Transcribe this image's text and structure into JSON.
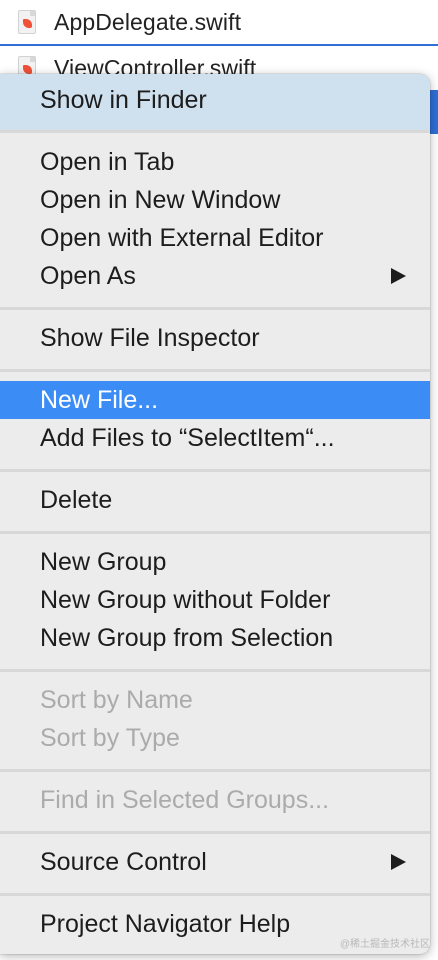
{
  "navigator": {
    "files": [
      {
        "name": "AppDelegate.swift",
        "icon": "swift-file-icon"
      },
      {
        "name": "ViewController.swift",
        "icon": "swift-file-icon"
      }
    ]
  },
  "context_menu": {
    "groups": [
      [
        {
          "label": "Show in Finder"
        }
      ],
      [
        {
          "label": "Open in Tab"
        },
        {
          "label": "Open in New Window"
        },
        {
          "label": "Open with External Editor"
        },
        {
          "label": "Open As",
          "submenu": true
        }
      ],
      [
        {
          "label": "Show File Inspector"
        }
      ],
      [
        {
          "label": "New File...",
          "highlighted": true
        },
        {
          "label": "Add Files to “SelectItem“..."
        }
      ],
      [
        {
          "label": "Delete"
        }
      ],
      [
        {
          "label": "New Group"
        },
        {
          "label": "New Group without Folder"
        },
        {
          "label": "New Group from Selection"
        }
      ],
      [
        {
          "label": "Sort by Name",
          "disabled": true
        },
        {
          "label": "Sort by Type",
          "disabled": true
        }
      ],
      [
        {
          "label": "Find in Selected Groups...",
          "disabled": true
        }
      ],
      [
        {
          "label": "Source Control",
          "submenu": true
        }
      ],
      [
        {
          "label": "Project Navigator Help"
        }
      ]
    ]
  },
  "watermark": "@稀土掘金技术社区",
  "colors": {
    "highlight": "#3b8cf5",
    "selection_line": "#2f6fd6",
    "menu_background": "#ececec",
    "disabled_text": "#ababab",
    "swift_icon": "#f05138"
  }
}
